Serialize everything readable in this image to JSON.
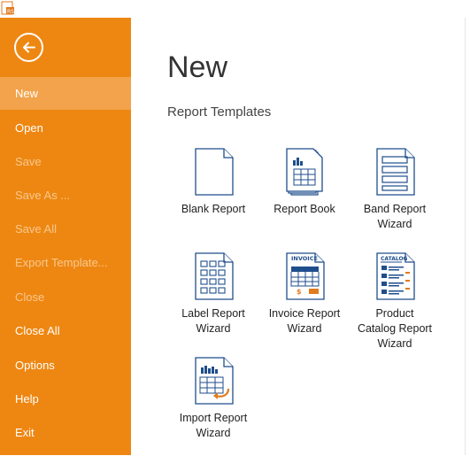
{
  "sidebar": {
    "back_label": "",
    "items": [
      {
        "label": "New",
        "state": "selected"
      },
      {
        "label": "Open",
        "state": "enabled"
      },
      {
        "label": "Save",
        "state": "disabled"
      },
      {
        "label": "Save As ...",
        "state": "disabled"
      },
      {
        "label": "Save All",
        "state": "disabled"
      },
      {
        "label": "Export Template...",
        "state": "disabled"
      },
      {
        "label": "Close",
        "state": "disabled"
      },
      {
        "label": "Close All",
        "state": "enabled"
      },
      {
        "label": "Options",
        "state": "enabled"
      },
      {
        "label": "Help",
        "state": "enabled"
      },
      {
        "label": "Exit",
        "state": "enabled"
      }
    ]
  },
  "main": {
    "title": "New",
    "section_title": "Report Templates",
    "templates": [
      {
        "label": "Blank Report",
        "icon": "blank-report-icon"
      },
      {
        "label": "Report Book",
        "icon": "report-book-icon"
      },
      {
        "label": "Band Report\nWizard",
        "icon": "band-report-icon"
      },
      {
        "label": "Label Report\nWizard",
        "icon": "label-report-icon"
      },
      {
        "label": "Invoice Report\nWizard",
        "icon": "invoice-report-icon",
        "icon_text": "INVOICE"
      },
      {
        "label": "Product\nCatalog Report\nWizard",
        "icon": "catalog-report-icon",
        "icon_text": "CATALOG"
      },
      {
        "label": "Import Report\nWizard",
        "icon": "import-report-icon"
      }
    ]
  },
  "colors": {
    "sidebar_bg": "#ee8712",
    "sidebar_selected": "#f2a34b",
    "sidebar_disabled_text": "#f8c88e",
    "icon_blue": "#1f4e8c",
    "icon_accent": "#e07b1f"
  }
}
